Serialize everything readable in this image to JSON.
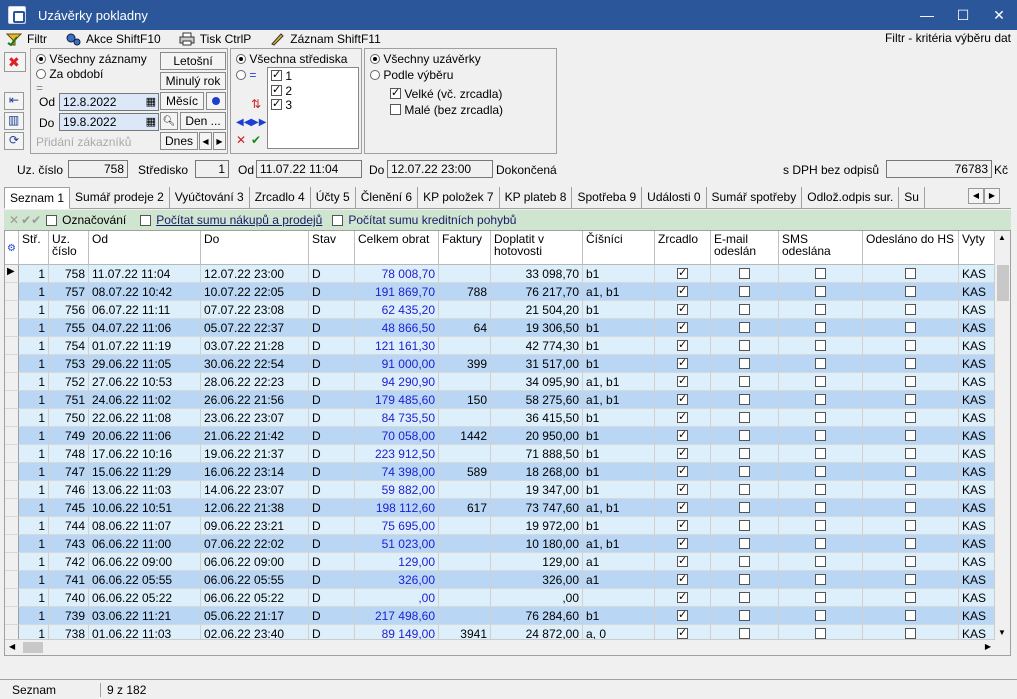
{
  "window": {
    "title": "Uzávěrky pokladny",
    "minimize": "—",
    "maximize": "☐",
    "close": "✕"
  },
  "menu": {
    "filter": "Filtr",
    "actions": "Akce ShiftF10",
    "print": "Tisk CtrlP",
    "record": "Záznam ShiftF11",
    "filter_caption": "Filtr - kritéria výběru dat"
  },
  "filter": {
    "all_records": "Všechny záznamy",
    "for_period": "Za období",
    "eq": "=",
    "from_label": "Od",
    "from_value": "12.8.2022",
    "to_label": "Do",
    "to_value": "19.8.2022",
    "adding_customers": "Přidání zákazníků",
    "this_year": "Letošní",
    "last_year": "Minulý rok",
    "month": "Měsíc",
    "day": "Den ...",
    "today": "Dnes",
    "all_centers": "Všechna střediska",
    "centers_eq": "=",
    "center_items": [
      "1",
      "2",
      "3"
    ],
    "all_closures": "Všechny uzávěrky",
    "by_selection": "Podle výběru",
    "big": "Velké (vč. zrcadla)",
    "small": "Malé (bez zrcadla)"
  },
  "record": {
    "no_label": "Uz. číslo",
    "no_value": "758",
    "center_label": "Středisko",
    "center_value": "1",
    "from_label": "Od",
    "from_value": "11.07.22 11:04",
    "to_label": "Do",
    "to_value": "12.07.22 23:00",
    "status": "Dokončená",
    "vat_label": "s DPH bez odpisů",
    "vat_value": "76783",
    "currency": "Kč"
  },
  "tabs": [
    "Seznam 1",
    "Sumář prodeje 2",
    "Vyúčtování 3",
    "Zrcadlo 4",
    "Účty 5",
    "Členění 6",
    "KP položek 7",
    "KP plateb 8",
    "Spotřeba 9",
    "Události 0",
    "Sumář spotřeby",
    "Odlož.odpis sur.",
    "Su"
  ],
  "toolbar": {
    "marking": "Označování",
    "sum_sales": "Počítat sumu nákupů a prodejů",
    "sum_credit": "Počítat sumu kreditních pohybů"
  },
  "columns": [
    "Stř.",
    "Uz. číslo",
    "Od",
    "Do",
    "Stav",
    "Celkem obrat",
    "Faktury",
    "Doplatit v hotovosti",
    "Číšníci",
    "Zrcadlo",
    "E-mail odeslán",
    "SMS odeslána",
    "Odesláno do HS",
    "Vyty"
  ],
  "rows": [
    [
      "1",
      "758",
      "11.07.22 11:04",
      "12.07.22 23:00",
      "D",
      "78 008,70",
      "",
      "33 098,70",
      "b1",
      "KAS"
    ],
    [
      "1",
      "757",
      "08.07.22 10:42",
      "10.07.22 22:05",
      "D",
      "191 869,70",
      "788",
      "76 217,70",
      "a1, b1",
      "KAS"
    ],
    [
      "1",
      "756",
      "06.07.22 11:11",
      "07.07.22 23:08",
      "D",
      "62 435,20",
      "",
      "21 504,20",
      "b1",
      "KAS"
    ],
    [
      "1",
      "755",
      "04.07.22 11:06",
      "05.07.22 22:37",
      "D",
      "48 866,50",
      "64",
      "19 306,50",
      "b1",
      "KAS"
    ],
    [
      "1",
      "754",
      "01.07.22 11:19",
      "03.07.22 21:28",
      "D",
      "121 161,30",
      "",
      "42 774,30",
      "b1",
      "KAS"
    ],
    [
      "1",
      "753",
      "29.06.22 11:05",
      "30.06.22 22:54",
      "D",
      "91 000,00",
      "399",
      "31 517,00",
      "b1",
      "KAS"
    ],
    [
      "1",
      "752",
      "27.06.22 10:53",
      "28.06.22 22:23",
      "D",
      "94 290,90",
      "",
      "34 095,90",
      "a1, b1",
      "KAS"
    ],
    [
      "1",
      "751",
      "24.06.22 11:02",
      "26.06.22 21:56",
      "D",
      "179 485,60",
      "150",
      "58 275,60",
      "a1, b1",
      "KAS"
    ],
    [
      "1",
      "750",
      "22.06.22 11:08",
      "23.06.22 23:07",
      "D",
      "84 735,50",
      "",
      "36 415,50",
      "b1",
      "KAS"
    ],
    [
      "1",
      "749",
      "20.06.22 11:06",
      "21.06.22 21:42",
      "D",
      "70 058,00",
      "1442",
      "20 950,00",
      "b1",
      "KAS"
    ],
    [
      "1",
      "748",
      "17.06.22 10:16",
      "19.06.22 21:37",
      "D",
      "223 912,50",
      "",
      "71 888,50",
      "b1",
      "KAS"
    ],
    [
      "1",
      "747",
      "15.06.22 11:29",
      "16.06.22 23:14",
      "D",
      "74 398,00",
      "589",
      "18 268,00",
      "b1",
      "KAS"
    ],
    [
      "1",
      "746",
      "13.06.22 11:03",
      "14.06.22 23:07",
      "D",
      "59 882,00",
      "",
      "19 347,00",
      "b1",
      "KAS"
    ],
    [
      "1",
      "745",
      "10.06.22 10:51",
      "12.06.22 21:38",
      "D",
      "198 112,60",
      "617",
      "73 747,60",
      "a1, b1",
      "KAS"
    ],
    [
      "1",
      "744",
      "08.06.22 11:07",
      "09.06.22 23:21",
      "D",
      "75 695,00",
      "",
      "19 972,00",
      "b1",
      "KAS"
    ],
    [
      "1",
      "743",
      "06.06.22 11:00",
      "07.06.22 22:02",
      "D",
      "51 023,00",
      "",
      "10 180,00",
      "a1, b1",
      "KAS"
    ],
    [
      "1",
      "742",
      "06.06.22 09:00",
      "06.06.22 09:00",
      "D",
      "129,00",
      "",
      "129,00",
      "a1",
      "KAS"
    ],
    [
      "1",
      "741",
      "06.06.22 05:55",
      "06.06.22 05:55",
      "D",
      "326,00",
      "",
      "326,00",
      "a1",
      "KAS"
    ],
    [
      "1",
      "740",
      "06.06.22 05:22",
      "06.06.22 05:22",
      "D",
      ",00",
      "",
      ",00",
      "",
      "KAS"
    ],
    [
      "1",
      "739",
      "03.06.22 11:21",
      "05.06.22 21:17",
      "D",
      "217 498,60",
      "",
      "76 284,60",
      "b1",
      "KAS"
    ],
    [
      "1",
      "738",
      "01.06.22 11:03",
      "02.06.22 23:40",
      "D",
      "89 149,00",
      "3941",
      "24 872,00",
      "a, 0",
      "KAS"
    ]
  ],
  "status": {
    "view": "Seznam",
    "position": "9 z 182"
  },
  "colors": {
    "titlebar": "#2b579a",
    "row_alt": "#b9d7f5",
    "row": "#ddeffb",
    "green": "#cfe5cf"
  }
}
